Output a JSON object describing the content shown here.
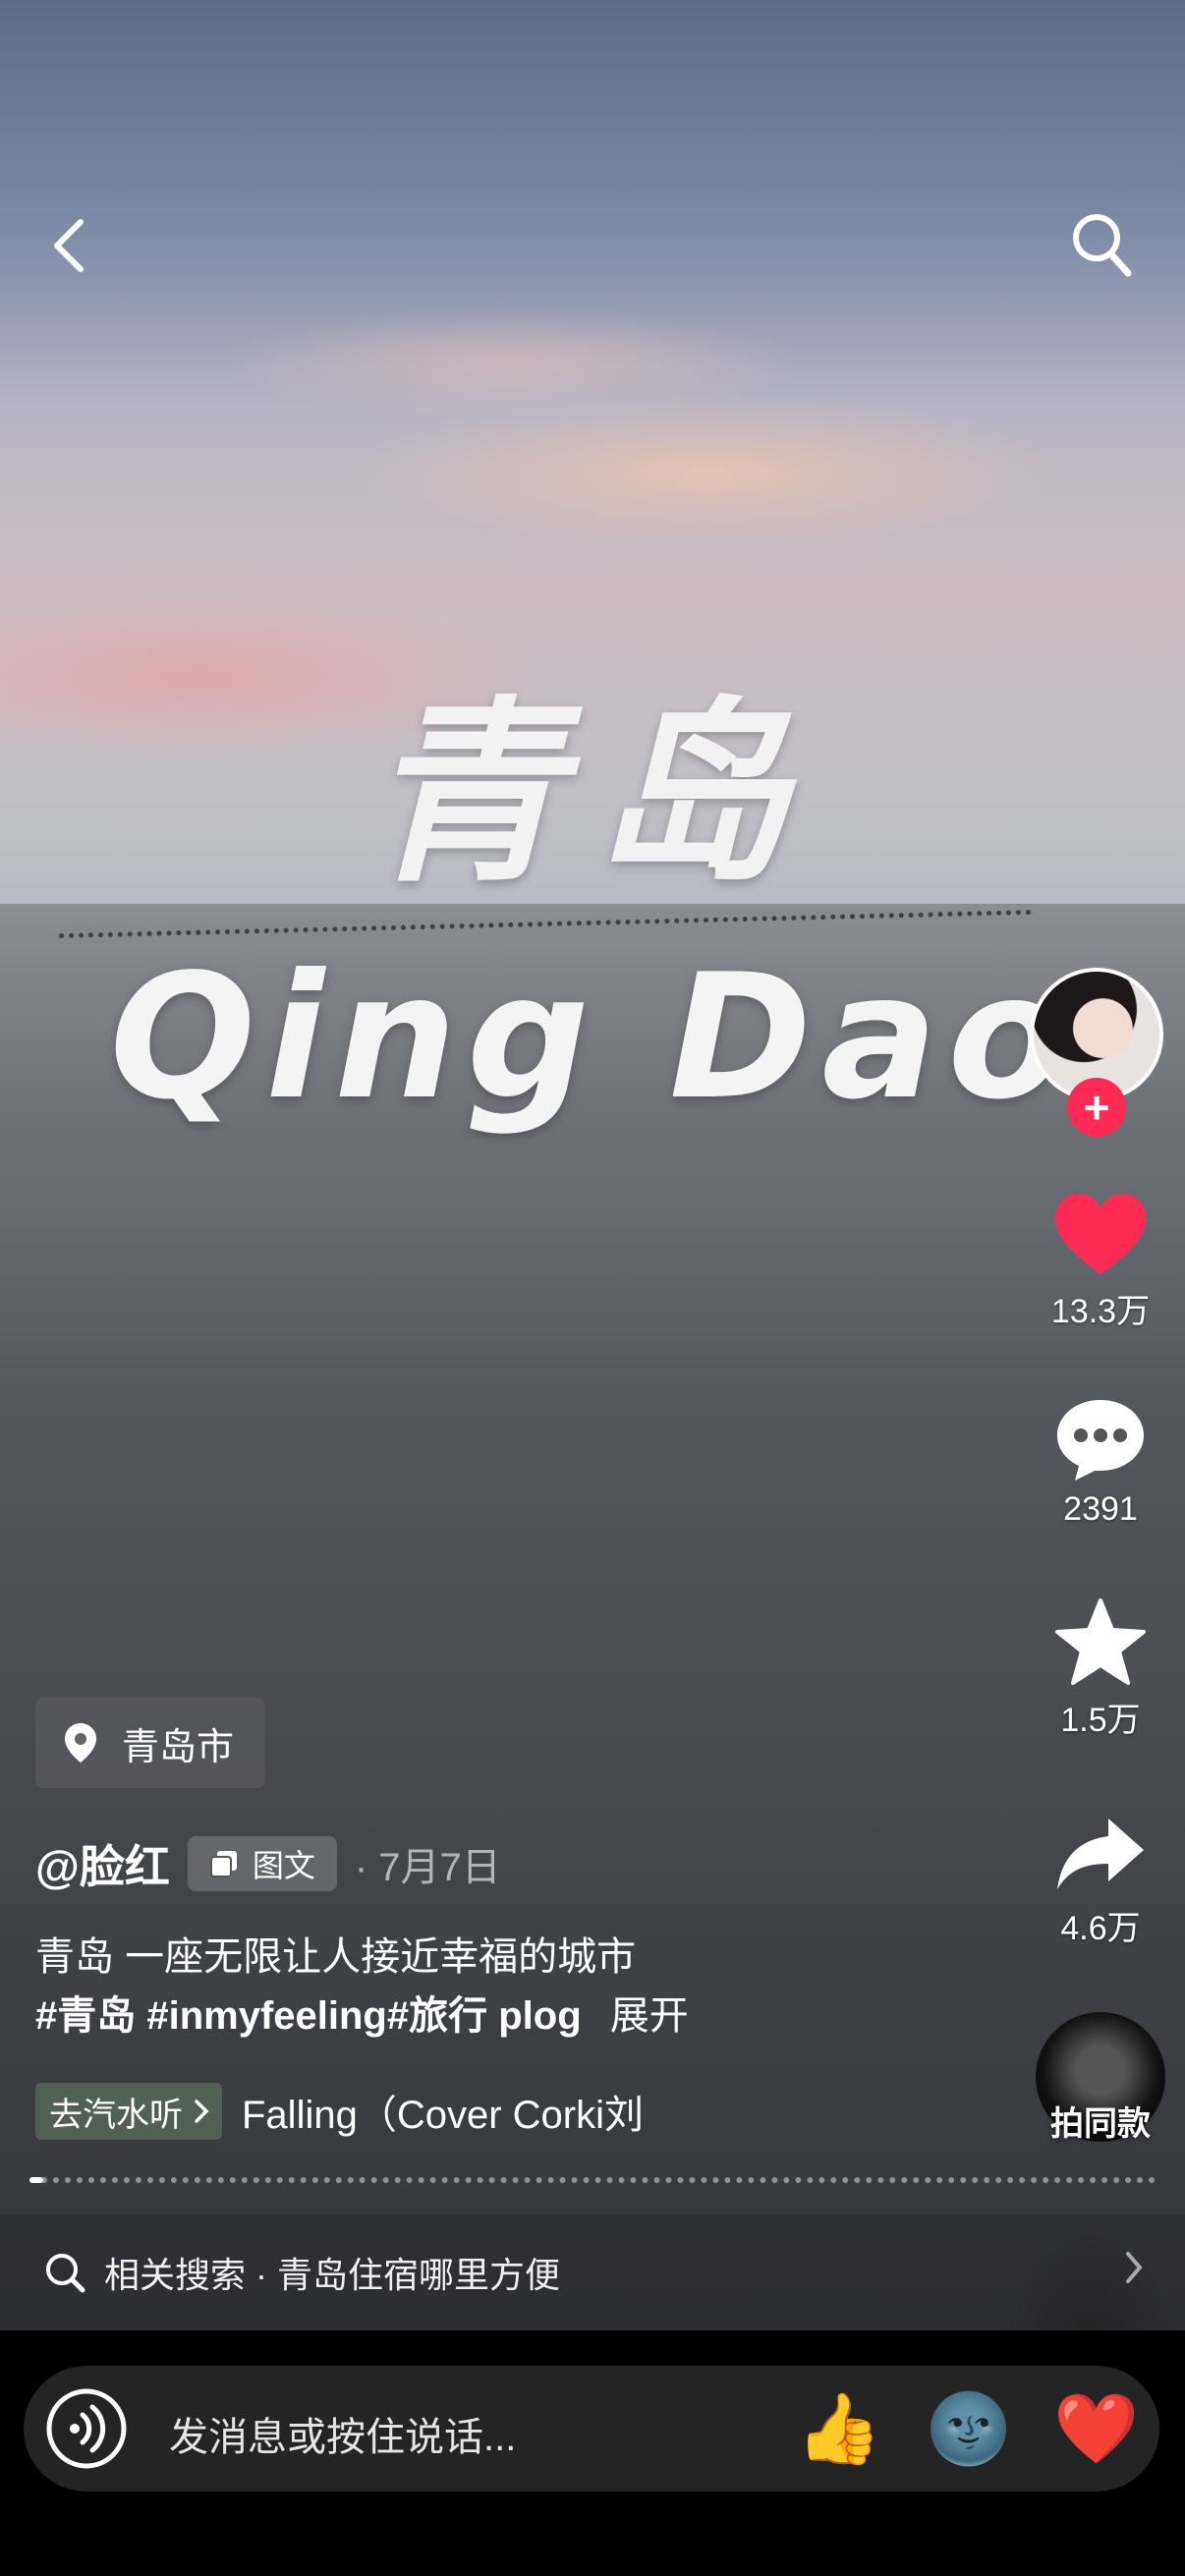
{
  "cover": {
    "title_zh": "青岛",
    "title_en": "Qing Dao"
  },
  "sidebar": {
    "likes": "13.3万",
    "comments": "2391",
    "favorites": "1.5万",
    "shares": "4.6万",
    "remix_label": "拍同款"
  },
  "post": {
    "location": "青岛市",
    "author": "@脸红",
    "type_label": "图文",
    "date": "· 7月7日",
    "caption_line1": "青岛 一座无限让人接近幸福的城市",
    "hashtags": "#青岛 #inmyfeeling#旅行 plog",
    "expand": "展开",
    "music_chip": "去汽水听",
    "music_title": "Falling（Cover Corki刘"
  },
  "related": {
    "text": "相关搜索 · 青岛住宿哪里方便"
  },
  "composer": {
    "placeholder": "发消息或按住说话..."
  },
  "emojis": [
    "👍",
    "🌚",
    "❤️"
  ],
  "colors": {
    "accent": "#fe2c55",
    "like": "#fe2c55"
  }
}
